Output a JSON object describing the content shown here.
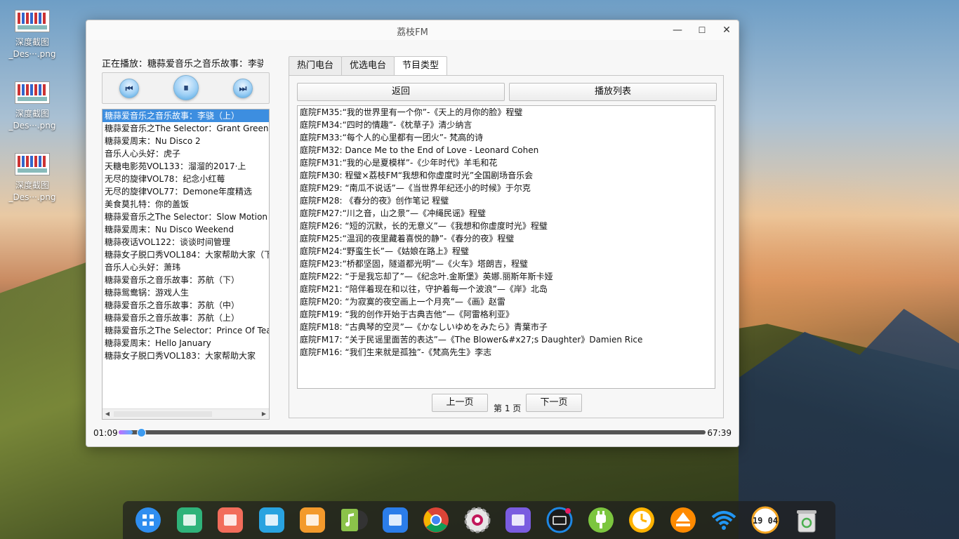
{
  "desktop": {
    "icons": [
      {
        "line1": "深度截图",
        "line2": "_Des···.png"
      },
      {
        "line1": "深度截图",
        "line2": "_Des···.png"
      },
      {
        "line1": "深度截图",
        "line2": "_Des···.png"
      }
    ]
  },
  "window": {
    "title": "荔枝FM",
    "minimize_glyph": "—",
    "maximize_glyph": "☐",
    "close_glyph": "✕"
  },
  "player": {
    "now_playing": "正在播放：糖蒜爱音乐之音乐故事：李骁...",
    "prev_glyph": "⏮",
    "pause_glyph": "⏸",
    "next_glyph": "⏭",
    "current_time": "01:09",
    "total_time": "67:39",
    "progress_fraction": 0.017
  },
  "playlist": {
    "selected_index": 0,
    "items": [
      "糖蒜爱音乐之音乐故事：李骁（上）",
      " 糖蒜爱音乐之The Selector：Grant Green",
      "糖蒜爱周末：Nu Disco 2",
      " 音乐人心头好：虎子",
      "天糖电影苑VOL133：溜溜的2017·上",
      "无尽的旋律VOL78：纪念小红莓",
      "无尽的旋律VOL77：Demone年度精选",
      " 美食莫扎特：你的盖饭",
      "糖蒜爱音乐之The Selector：Slow Motion",
      " 糖蒜爱周末：Nu Disco Weekend",
      "糖蒜夜话VOL122：谈谈时间管理",
      "糖蒜女子脱口秀VOL184：大家帮助大家（下",
      "音乐人心头好：萧玮",
      "糖蒜爱音乐之音乐故事：苏航（下）",
      "糖蒜鸳鸯锅：游戏人生",
      "糖蒜爱音乐之音乐故事：苏航（中）",
      "糖蒜爱音乐之音乐故事：苏航（上）",
      "糖蒜爱音乐之The Selector：Prince Of Tears",
      "糖蒜爱周末：Hello January",
      "糖蒜女子脱口秀VOL183：大家帮助大家"
    ]
  },
  "tabs": {
    "items": [
      "热门电台",
      "优选电台",
      "节目类型"
    ],
    "active_index": 2
  },
  "programs": {
    "back_label": "返回",
    "playlist_label": "播放列表",
    "prev_page_label": "上一页",
    "page_label": "第 1 页",
    "next_page_label": "下一页",
    "items": [
      "庭院FM35:“我的世界里有一个你”-《天上的月你的脸》程璧",
      "庭院FM34:“四时的情趣”-《枕草子》清少纳言",
      "庭院FM33:“每个人的心里都有一团火”- 梵高的诗",
      "庭院FM32: Dance Me to the End of Love - Leonard Cohen",
      "庭院FM31:“我的心是夏模样”-《少年时代》羊毛和花",
      "庭院FM30: 程璧×荔枝FM“我想和你虚度时光”全国剧场音乐会",
      "庭院FM29: “南瓜不说话”—《当世界年纪还小的时候》于尔克",
      "庭院FM28: 《春分的夜》创作笔记 程璧",
      "庭院FM27:“川之音，山之景”—《冲绳民谣》程璧",
      "庭院FM26: “短的沉默，长的无意义”—《我想和你虚度时光》程璧",
      "庭院FM25:“温润的夜里藏着喜悦的静”-《春分的夜》程璧",
      "庭院FM24:“野蛮生长”—《姑娘在路上》程璧",
      "庭院FM23:“桥都坚固，隧道都光明”—《火车》塔朗吉，程璧",
      "庭院FM22: “于是我忘却了”—《纪念叶.金斯堡》英娜.丽斯年斯卡娅",
      "庭院FM21: “陪伴着现在和以往，守护着每一个波浪”—《岸》北岛",
      "庭院FM20: “为寂寞的夜空画上一个月亮”—《画》赵雷",
      "庭院FM19: “我的创作开始于古典吉他”—《阿雷格利亚》",
      "庭院FM18: “古典琴的空灵”—《かなしいゆめをみたら》青葉市子",
      "庭院FM17: “关于民谣里面苦的表达”—《The Blower&#x27;s Daughter》Damien Rice",
      "庭院FM16: “我们生来就是孤独”-《梵高先生》李志"
    ]
  },
  "dock": {
    "items": [
      {
        "icon": "launcher-icon",
        "color": "#2f8ef0"
      },
      {
        "icon": "file-manager-icon",
        "color": "#2fb37a"
      },
      {
        "icon": "screen-recorder-icon",
        "color": "#f26d5b"
      },
      {
        "icon": "file-archiver-icon",
        "color": "#29a3e0"
      },
      {
        "icon": "app-store-icon",
        "color": "#f39a2c"
      },
      {
        "icon": "music-player-icon",
        "color": "#8bc34a"
      },
      {
        "icon": "movie-player-icon",
        "color": "#2b7de9"
      },
      {
        "icon": "chrome-icon",
        "color": "#e34133"
      },
      {
        "icon": "system-settings-icon",
        "color": "#d9d9d9"
      },
      {
        "icon": "control-center-icon",
        "color": "#7a5ce0"
      },
      {
        "icon": "keyboard-indicator-icon",
        "color": "#1e88e5"
      },
      {
        "icon": "power-plug-icon",
        "color": "#7cc63f"
      },
      {
        "icon": "clock-app-icon",
        "color": "#ffb300"
      },
      {
        "icon": "eject-icon",
        "color": "#ff8a00"
      },
      {
        "icon": "wifi-icon",
        "color": "#2196f3"
      },
      {
        "icon": "digital-clock-icon",
        "color": "#ffffff"
      },
      {
        "icon": "trash-icon",
        "color": "#bdbdbd"
      }
    ],
    "clock_text": "19 04"
  }
}
